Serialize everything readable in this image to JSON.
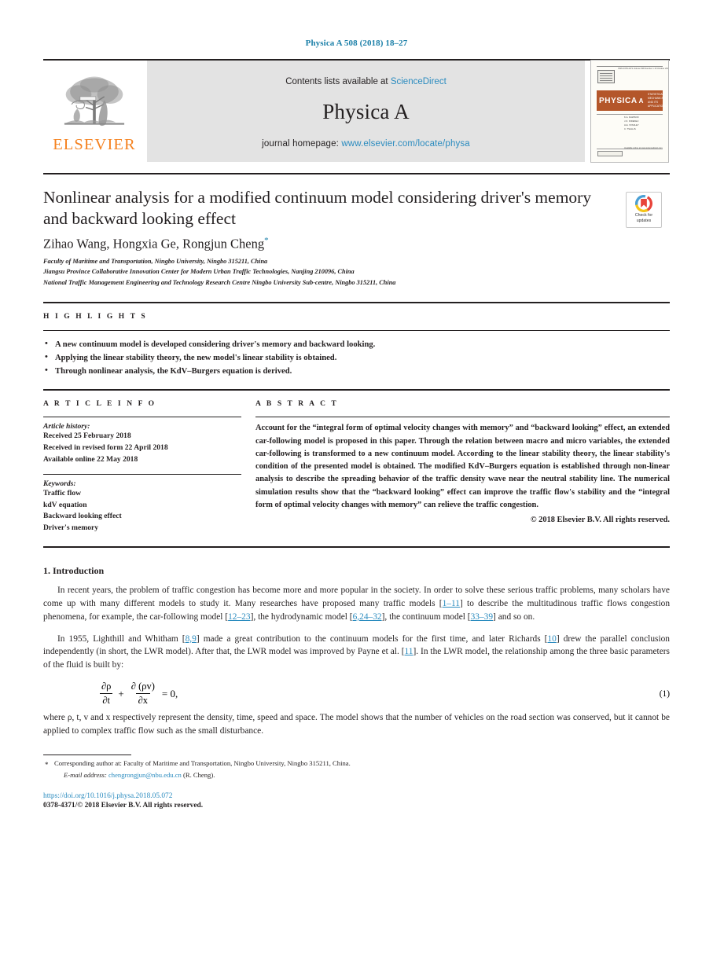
{
  "running_head": "Physica A 508 (2018) 18–27",
  "masthead": {
    "contents_prefix": "Contents lists available at ",
    "sciencedirect": "ScienceDirect",
    "journal_name": "Physica A",
    "homepage_prefix": "journal homepage: ",
    "homepage_url": "www.elsevier.com/locate/physa",
    "publisher": "ELSEVIER",
    "cover": {
      "title": "PHYSICA",
      "letter": "A",
      "subtitle": "STATISTICAL MECHANICS\nAND ITS APPLICATIONS"
    }
  },
  "article": {
    "title": "Nonlinear analysis for a modified continuum model considering driver's memory and backward looking effect",
    "authors": "Zihao Wang, Hongxia Ge, Rongjun Cheng",
    "author_marker": "*",
    "affiliations": [
      "Faculty of Maritime and Transportation, Ningbo University, Ningbo 315211, China",
      "Jiangsu Province Collaborative Innovation Center for Modern Urban Traffic Technologies, Nanjing 210096, China",
      "National Traffic Management Engineering and Technology Research Centre Ningbo University Sub-centre, Ningbo 315211, China"
    ],
    "crossmark": {
      "line1": "Check for",
      "line2": "updates"
    }
  },
  "highlights": {
    "label": "H I G H L I G H T S",
    "items": [
      "A new continuum model is developed considering driver's memory and backward looking.",
      "Applying the linear stability theory, the new model's linear stability is obtained.",
      "Through nonlinear analysis, the KdV–Burgers equation is derived."
    ]
  },
  "info": {
    "label": "A R T I C L E    I N F O",
    "history_label": "Article history:",
    "history": [
      "Received 25 February 2018",
      "Received in revised form 22 April 2018",
      "Available online 22 May 2018"
    ],
    "keywords_label": "Keywords:",
    "keywords": [
      "Traffic flow",
      "kdV equation",
      "Backward looking effect",
      "Driver's memory"
    ]
  },
  "abstract": {
    "label": "A B S T R A C T",
    "text": "Account for the “integral form of optimal velocity changes with memory” and “backward looking” effect, an extended car-following model is proposed in this paper. Through the relation between macro and micro variables, the extended car-following is transformed to a new continuum model. According to the linear stability theory, the linear stability's condition of the presented model is obtained. The modified KdV–Burgers equation is established through non-linear analysis to describe the spreading behavior of the traffic density wave near the neutral stability line. The numerical simulation results show that the “backward looking” effect can improve the traffic flow's stability and the “integral form of optimal velocity changes with memory” can relieve the traffic congestion.",
    "copyright": "© 2018 Elsevier B.V. All rights reserved."
  },
  "body": {
    "section_heading": "1. Introduction",
    "para1_a": "In recent years, the problem of traffic congestion has become more and more popular in the society. In order to solve these serious traffic problems, many scholars have come up with many different models to study it. Many researches have proposed many traffic models [",
    "cite_1_11": "1–11",
    "para1_b": "] to describe the multitudinous traffic flows congestion phenomena, for example, the car-following model [",
    "cite_12_23": "12–23",
    "para1_c": "], the hydrodynamic model [",
    "cite_6_24_32": "6,24–32",
    "para1_d": "], the continuum model [",
    "cite_33_39": "33–39",
    "para1_e": "] and so on.",
    "para2_a": "In 1955, Lighthill and Whitham [",
    "cite_8_9": "8,9",
    "para2_b": "] made a great contribution to the continuum models for the first time, and later Richards [",
    "cite_10": "10",
    "para2_c": "] drew the parallel conclusion independently (in short, the LWR model). After that, the LWR model was improved by Payne et al. [",
    "cite_11": "11",
    "para2_d": "]. In the LWR model, the relationship among the three basic parameters of the fluid is built by:",
    "equation": {
      "num_rho": "∂ρ",
      "den_t": "∂t",
      "plus": "+",
      "num_rhov": "∂ (ρv)",
      "den_x": "∂x",
      "equals": "= 0,",
      "label": "(1)"
    },
    "para3": "where ρ, t, v and x respectively represent the density, time, speed and space. The model shows that the number of vehicles on the road section was conserved, but it cannot be applied to complex traffic flow such as the small disturbance."
  },
  "footer": {
    "corresponding": "Corresponding author at: Faculty of Maritime and Transportation, Ningbo University, Ningbo 315211, China.",
    "email_label": "E-mail address:",
    "email": "chengrongjun@nbu.edu.cn",
    "email_suffix": "(R. Cheng).",
    "doi": "https://doi.org/10.1016/j.physa.2018.05.072",
    "issn": "0378-4371/© 2018 Elsevier B.V. All rights reserved."
  },
  "colors": {
    "link": "#2a8bbf",
    "running_head": "#1a7fa8",
    "elsevier_orange": "#f58220",
    "cover_band": "#b4562a"
  }
}
